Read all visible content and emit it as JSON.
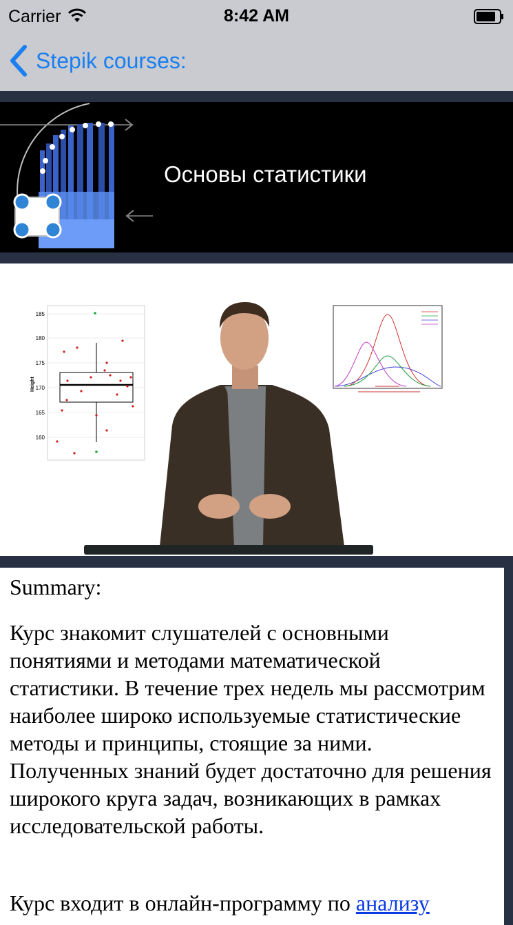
{
  "status_bar": {
    "carrier": "Carrier",
    "time": "8:42 AM"
  },
  "nav": {
    "back_label": "Stepik courses:"
  },
  "course": {
    "title": "Основы статистики"
  },
  "video": {
    "boxplot_ylabel": "Height",
    "boxplot_ticks": [
      "185",
      "180",
      "175",
      "170",
      "165",
      "160"
    ]
  },
  "summary": {
    "heading": "Summary:",
    "paragraph": "Курс знакомит слушателей с основными понятиями и методами математической статистики. В течение трех недель мы рассмотрим наиболее широко используемые статистические методы и принципы, стоящие за ними. Полученных знаний будет достаточно для решения широкого круга задач, возникающих в рамках исследовательской работы.",
    "paragraph2_prefix": "Курс входит в онлайн-программу по ",
    "paragraph2_link": "анализу"
  },
  "colors": {
    "accent": "#1a7ff0",
    "nav_background": "#c9cbd0",
    "page_background": "#283043",
    "link": "#0a3ae6"
  }
}
